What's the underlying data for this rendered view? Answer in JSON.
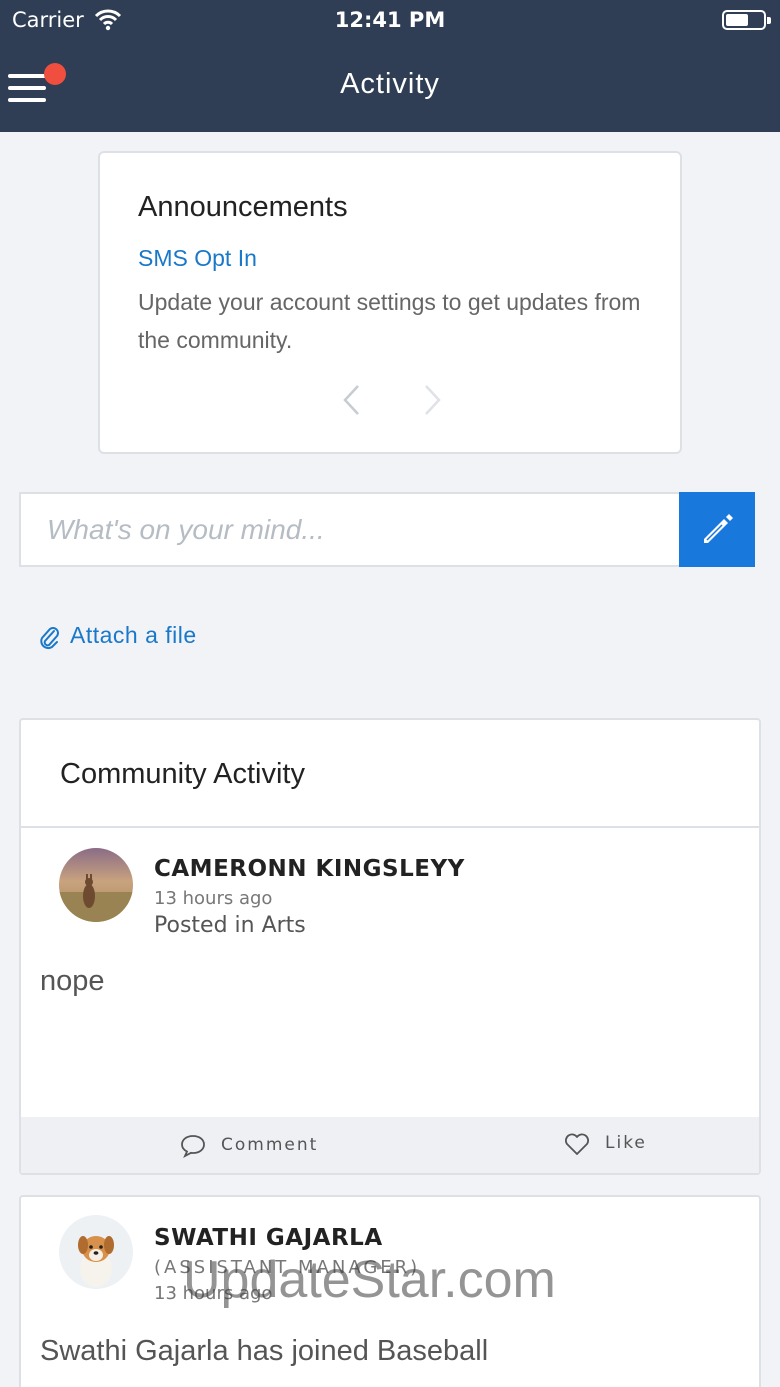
{
  "status_bar": {
    "carrier": "Carrier",
    "time": "12:41 PM"
  },
  "nav": {
    "title": "Activity",
    "menu_icon": "hamburger-menu-icon",
    "notification_color": "#f04e3e"
  },
  "announcements": {
    "heading": "Announcements",
    "item_title": "SMS Opt In",
    "item_body": "Update your account settings to get updates from the community."
  },
  "composer": {
    "placeholder": "What's on your mind...",
    "attach_label": "Attach a file",
    "accent_color": "#1878db"
  },
  "community": {
    "heading": "Community Activity",
    "posts": [
      {
        "author": "CAMERONN KINGSLEYY",
        "time": "13 hours ago",
        "location": "Posted in Arts",
        "body": "nope",
        "comment_label": "Comment",
        "like_label": "Like"
      },
      {
        "author": "SWATHI GAJARLA",
        "role": "(ASSISTANT MANAGER)",
        "time": "13 hours ago",
        "body": "Swathi Gajarla has joined Baseball"
      }
    ]
  },
  "watermark": "UpdateStar.com"
}
